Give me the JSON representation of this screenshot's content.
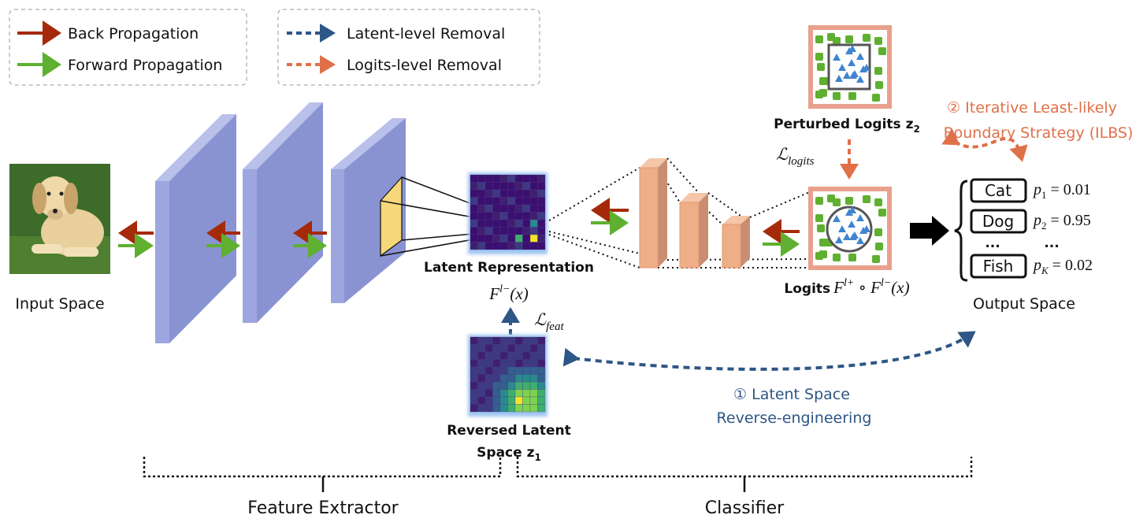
{
  "legend": {
    "left": [
      {
        "label": "Back Propagation",
        "color": "#a52a0a",
        "style": "solid"
      },
      {
        "label": "Forward Propagation",
        "color": "#5fb030",
        "style": "solid"
      }
    ],
    "right": [
      {
        "label": "Latent-level Removal",
        "color": "#2e5686",
        "style": "dashed"
      },
      {
        "label": "Logits-level Removal",
        "color": "#e0704a",
        "style": "dashed"
      }
    ]
  },
  "input": {
    "label": "Input Space",
    "icon": "dog-photo"
  },
  "latent": {
    "label": "Latent Representation",
    "formula": "F",
    "formula_sup": "l−",
    "formula_arg": "(x)",
    "loss": "ℒ",
    "loss_sub": "feat"
  },
  "reversed": {
    "label_line1": "Reversed Latent",
    "label_line2": "Space z",
    "label_sub": "1"
  },
  "perturbed": {
    "label": "Perturbed Logits z",
    "label_sub": "2",
    "loss": "ℒ",
    "loss_sub": "logits"
  },
  "logits": {
    "label": "Logits",
    "f1": "F",
    "f1_sup": "l+",
    "op": " ∘ ",
    "f2": "F",
    "f2_sup": "l−",
    "arg": "(x)"
  },
  "output": {
    "label": "Output Space",
    "classes": [
      {
        "name": "Cat",
        "p": "p",
        "sub": "1",
        "value": "= 0.01"
      },
      {
        "name": "Dog",
        "p": "p",
        "sub": "2",
        "value": "= 0.95"
      },
      {
        "name": "...",
        "p": "",
        "sub": "",
        "value": "..."
      },
      {
        "name": "Fish",
        "p": "p",
        "sub": "K",
        "value": "= 0.02"
      }
    ]
  },
  "ilbs": {
    "number": "②",
    "line1": "Iterative Least-likely",
    "line2": "Boundary Strategy (ILBS)",
    "color": "#e0704a"
  },
  "lsre": {
    "number": "①",
    "line1": "Latent Space",
    "line2": "Reverse-engineering",
    "color": "#2e5686"
  },
  "sections": {
    "feature_extractor": "Feature Extractor",
    "classifier": "Classifier"
  }
}
